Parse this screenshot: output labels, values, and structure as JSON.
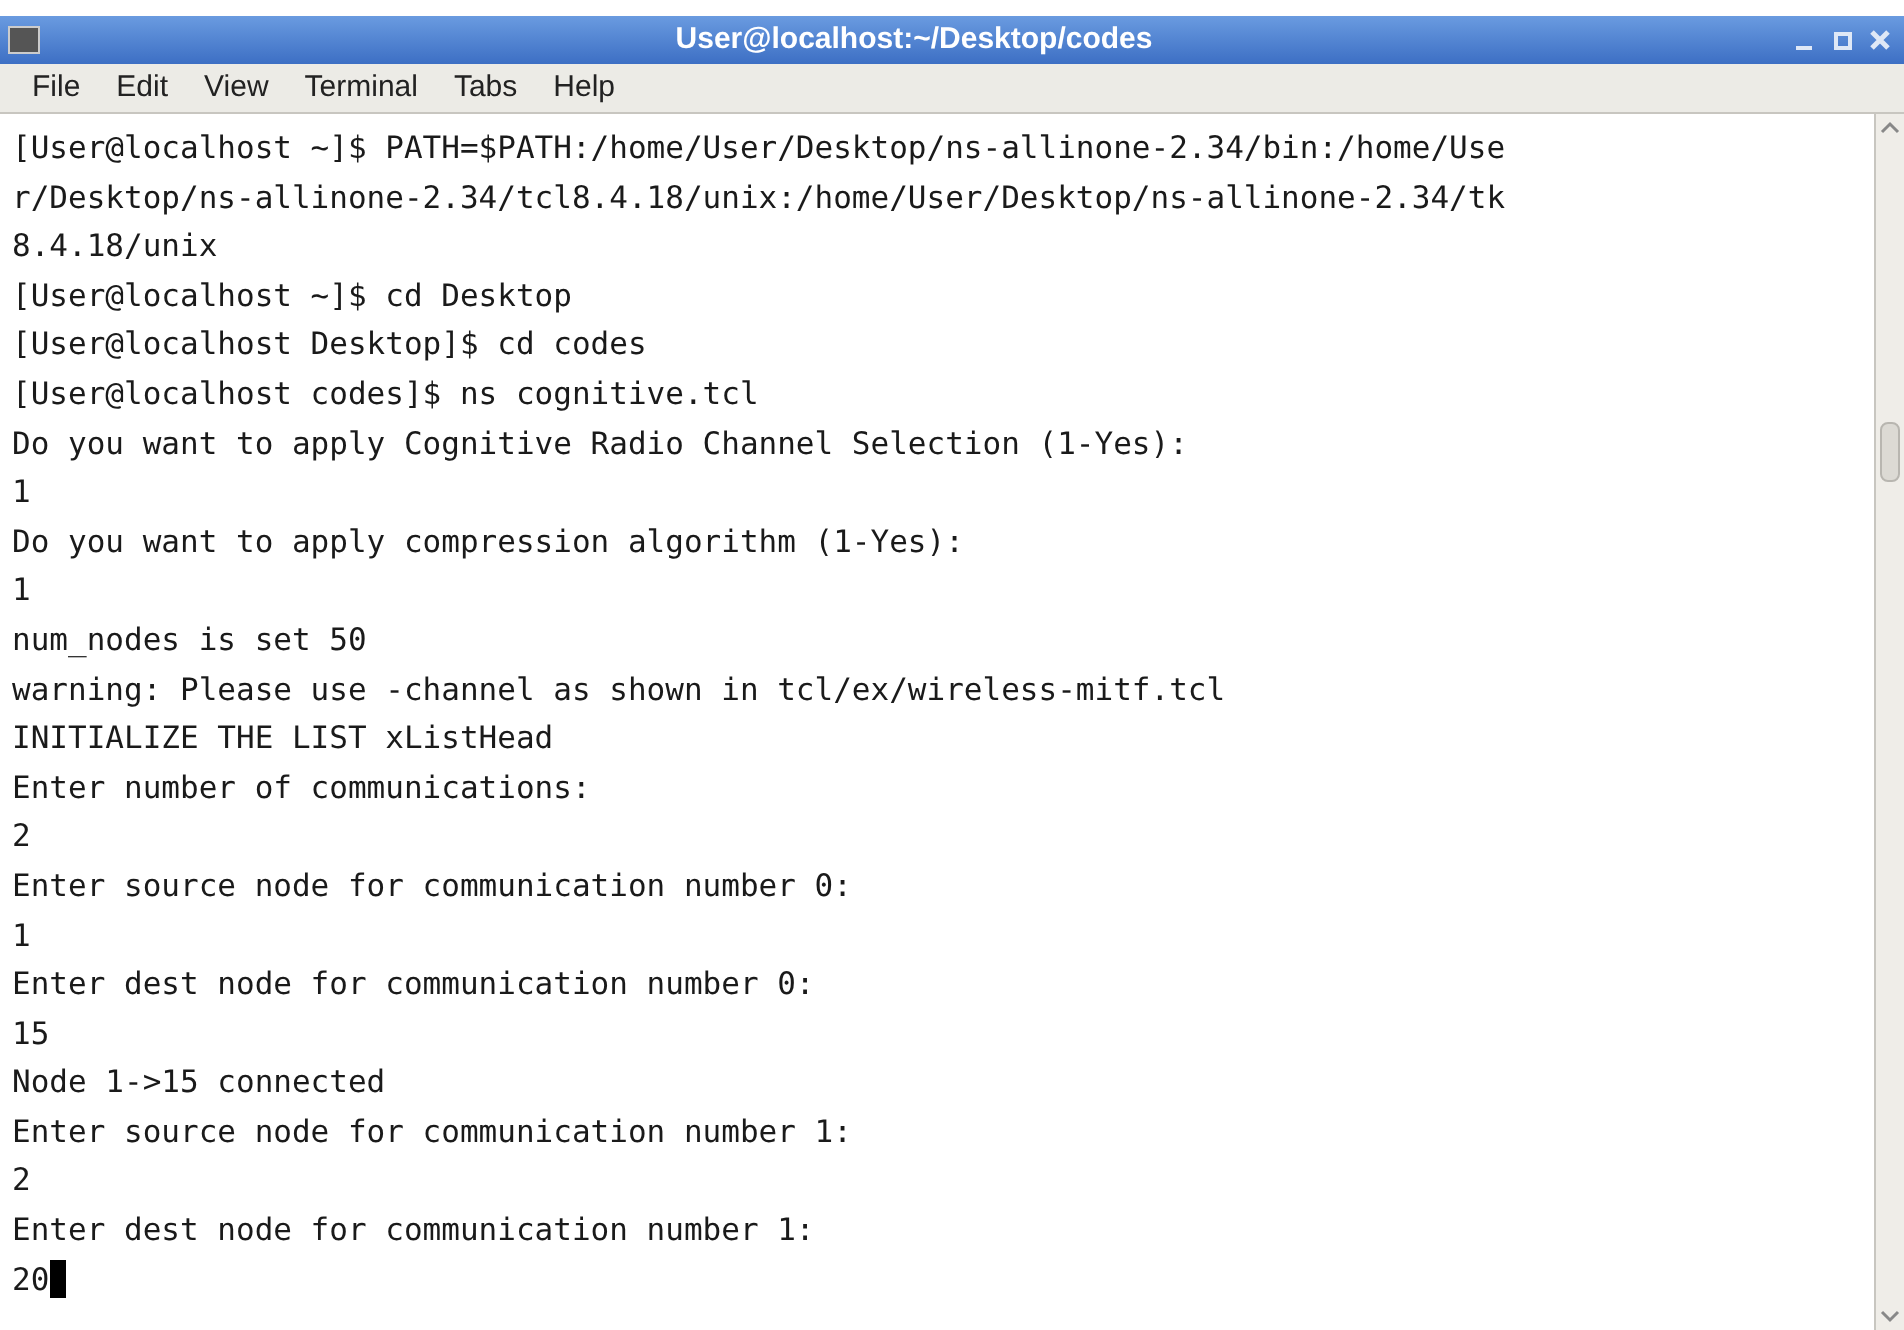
{
  "window": {
    "title": "User@localhost:~/Desktop/codes"
  },
  "menu": [
    "File",
    "Edit",
    "View",
    "Terminal",
    "Tabs",
    "Help"
  ],
  "terminal": {
    "lines": [
      "[User@localhost ~]$ PATH=$PATH:/home/User/Desktop/ns-allinone-2.34/bin:/home/Use",
      "r/Desktop/ns-allinone-2.34/tcl8.4.18/unix:/home/User/Desktop/ns-allinone-2.34/tk",
      "8.4.18/unix",
      "[User@localhost ~]$ cd Desktop",
      "[User@localhost Desktop]$ cd codes",
      "[User@localhost codes]$ ns cognitive.tcl",
      "Do you want to apply Cognitive Radio Channel Selection (1-Yes):",
      "1",
      "Do you want to apply compression algorithm (1-Yes):",
      "1",
      "num_nodes is set 50",
      "warning: Please use -channel as shown in tcl/ex/wireless-mitf.tcl",
      "INITIALIZE THE LIST xListHead",
      "Enter number of communications:",
      "2",
      "Enter source node for communication number 0:",
      "1",
      "Enter dest node for communication number 0:",
      "15",
      "Node 1->15 connected",
      "Enter source node for communication number 1:",
      "2",
      "Enter dest node for communication number 1:",
      "20"
    ]
  }
}
